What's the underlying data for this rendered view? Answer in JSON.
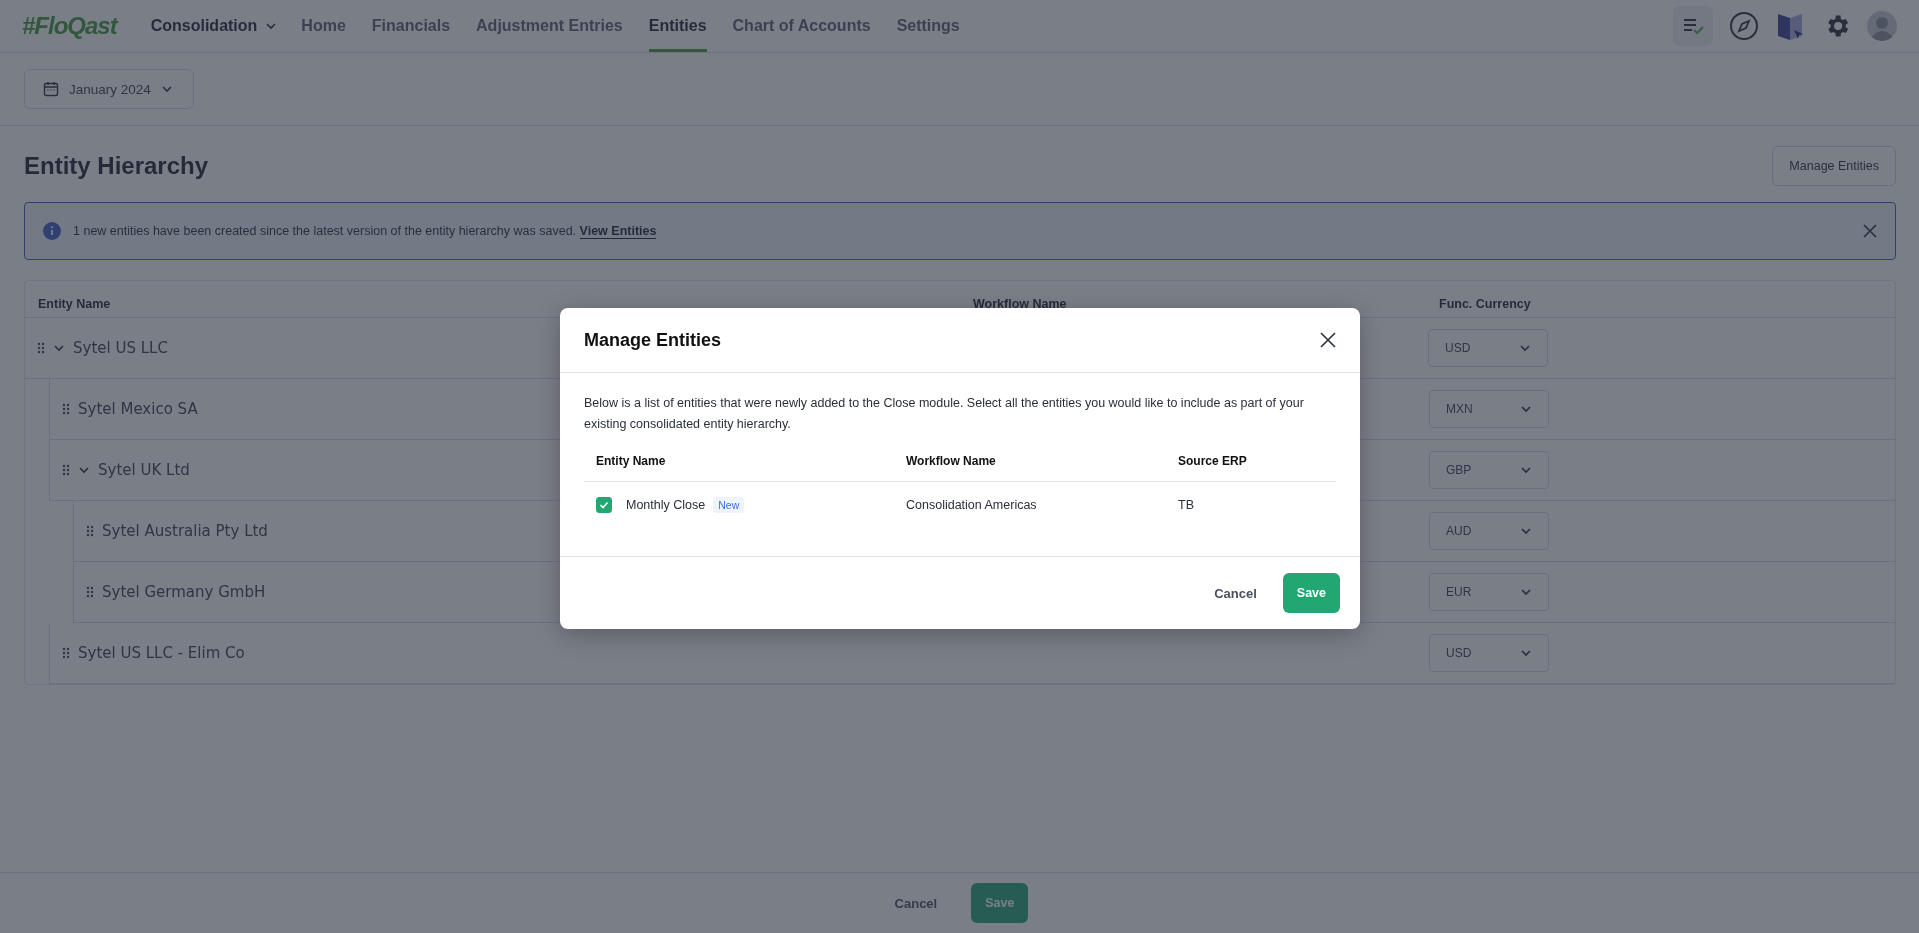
{
  "nav": {
    "logo": "#FloQast",
    "module": "Consolidation",
    "items": [
      {
        "label": "Home",
        "selected": false
      },
      {
        "label": "Financials",
        "selected": false
      },
      {
        "label": "Adjustment Entries",
        "selected": false
      },
      {
        "label": "Entities",
        "selected": true
      },
      {
        "label": "Chart of Accounts",
        "selected": false
      },
      {
        "label": "Settings",
        "selected": false
      }
    ]
  },
  "period": "January 2024",
  "page_title": "Entity Hierarchy",
  "manage_button": "Manage Entities",
  "banner": {
    "message": "1 new entities have been created since the latest version of the entity hierarchy was saved.",
    "link": "View Entities"
  },
  "table": {
    "columns": [
      "Entity Name",
      "Workflow Name",
      "Func. Currency"
    ],
    "rows": [
      {
        "name": "Sytel US LLC",
        "currency": "USD",
        "expanded": true,
        "children": [
          {
            "name": "Sytel Mexico SA",
            "currency": "MXN"
          },
          {
            "name": "Sytel UK Ltd",
            "currency": "GBP",
            "expanded": true,
            "children": [
              {
                "name": "Sytel Australia Pty Ltd",
                "currency": "AUD"
              },
              {
                "name": "Sytel Germany GmbH",
                "currency": "EUR"
              }
            ]
          },
          {
            "name": "Sytel US LLC - Elim Co",
            "currency": "USD"
          }
        ]
      }
    ]
  },
  "modal": {
    "title": "Manage Entities",
    "description": "Below is a list of entities that were newly added to the Close module. Select all the entities you would like to include as part of your existing consolidated entity hierarchy.",
    "columns": [
      "Entity Name",
      "Workflow Name",
      "Source ERP"
    ],
    "rows": [
      {
        "checked": true,
        "entity": "Monthly Close",
        "badge": "New",
        "workflow": "Consolidation Americas",
        "source": "TB"
      }
    ],
    "cancel": "Cancel",
    "save": "Save"
  },
  "footer": {
    "cancel": "Cancel",
    "save": "Save"
  }
}
